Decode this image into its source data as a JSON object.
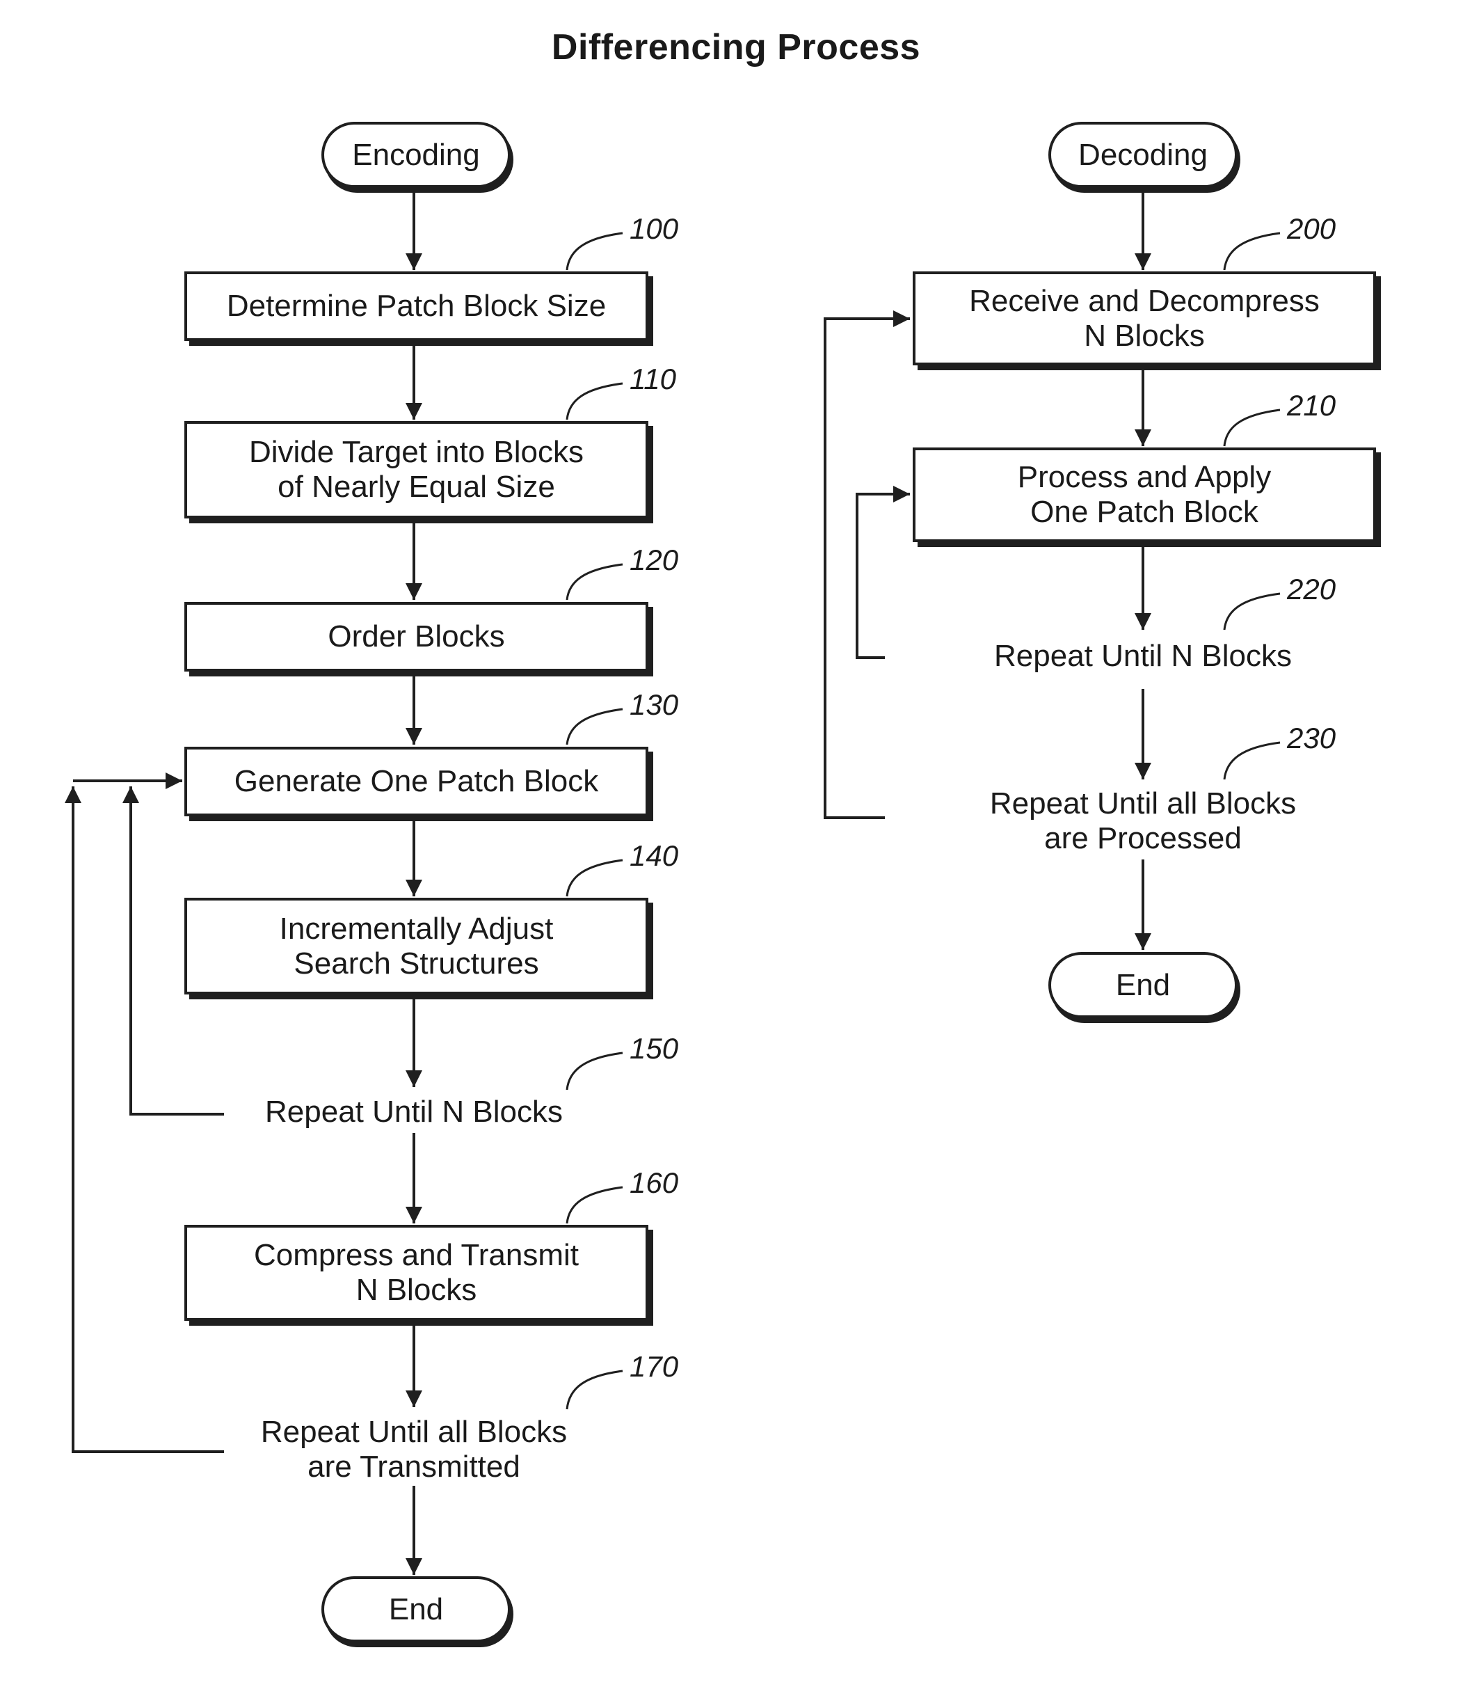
{
  "title": "Differencing Process",
  "encoding": {
    "start": "Encoding",
    "steps": [
      {
        "ref": "100",
        "label": "Determine Patch Block Size",
        "kind": "box"
      },
      {
        "ref": "110",
        "label": "Divide Target into Blocks\nof Nearly Equal Size",
        "kind": "box"
      },
      {
        "ref": "120",
        "label": "Order Blocks",
        "kind": "box"
      },
      {
        "ref": "130",
        "label": "Generate One Patch Block",
        "kind": "box"
      },
      {
        "ref": "140",
        "label": "Incrementally Adjust\nSearch Structures",
        "kind": "box"
      },
      {
        "ref": "150",
        "label": "Repeat Until N Blocks",
        "kind": "loop",
        "loops_to": "130"
      },
      {
        "ref": "160",
        "label": "Compress and Transmit\nN Blocks",
        "kind": "box"
      },
      {
        "ref": "170",
        "label": "Repeat Until all Blocks\nare Transmitted",
        "kind": "loop",
        "loops_to": "130"
      }
    ],
    "end": "End"
  },
  "decoding": {
    "start": "Decoding",
    "steps": [
      {
        "ref": "200",
        "label": "Receive and Decompress\nN Blocks",
        "kind": "box"
      },
      {
        "ref": "210",
        "label": "Process and Apply\nOne Patch Block",
        "kind": "box"
      },
      {
        "ref": "220",
        "label": "Repeat Until N Blocks",
        "kind": "loop",
        "loops_to": "210"
      },
      {
        "ref": "230",
        "label": "Repeat Until all Blocks\nare Processed",
        "kind": "loop",
        "loops_to": "200"
      }
    ],
    "end": "End"
  }
}
